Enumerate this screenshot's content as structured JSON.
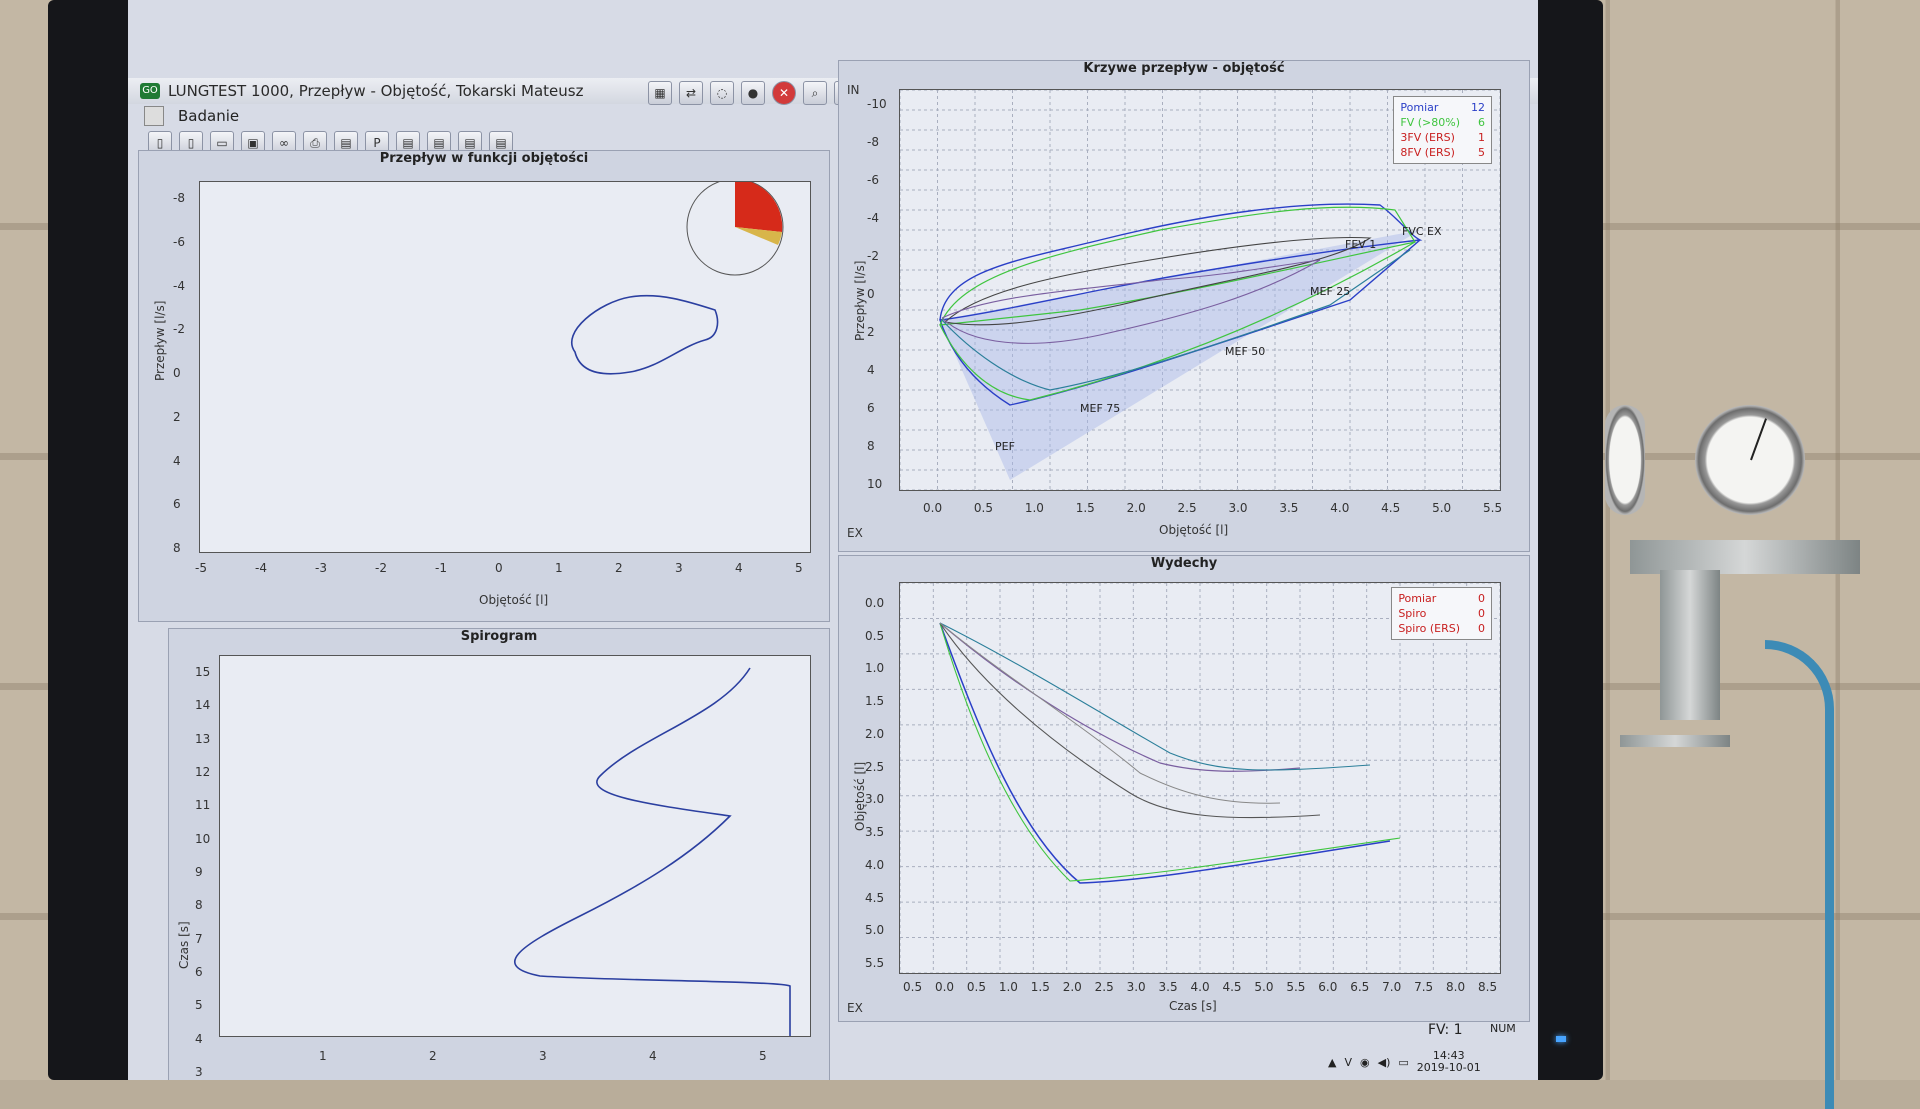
{
  "window": {
    "title": "LUNGTEST 1000,  Przepływ - Objętość,  Tokarski Mateusz",
    "logo_text": "GO"
  },
  "menu": {
    "items": [
      "Badanie"
    ]
  },
  "toolbar": {
    "zero_label": "0",
    "help_label": "?"
  },
  "panels": {
    "flow_volume": {
      "title": "Przepływ w funkcji objętości",
      "ylabel": "Przepływ [l/s]",
      "xlabel": "Objętość [l]",
      "yticks": [
        "-8",
        "-6",
        "-4",
        "-2",
        "0",
        "2",
        "4",
        "6",
        "8"
      ],
      "xticks": [
        "-5",
        "-4",
        "-3",
        "-2",
        "-1",
        "0",
        "1",
        "2",
        "3",
        "4",
        "5"
      ]
    },
    "curves": {
      "title": "Krzywe przepływ - objętość",
      "ylabel": "Przepływ [l/s]",
      "xlabel": "Objętość [l]",
      "corner_in": "IN",
      "corner_ex": "EX",
      "yticks": [
        "-10",
        "-8",
        "-6",
        "-4",
        "-2",
        "0",
        "2",
        "4",
        "6",
        "8",
        "10"
      ],
      "xticks": [
        "0.0",
        "0.5",
        "1.0",
        "1.5",
        "2.0",
        "2.5",
        "3.0",
        "3.5",
        "4.0",
        "4.5",
        "5.0",
        "5.5"
      ],
      "legend": [
        {
          "label": "Pomiar",
          "value": "12",
          "color": "#2a3fc7"
        },
        {
          "label": "FV (>80%)",
          "value": "6",
          "color": "#3fc53f"
        },
        {
          "label": "3FV (ERS)",
          "value": "1",
          "color": "#c82020"
        },
        {
          "label": "8FV (ERS)",
          "value": "5",
          "color": "#c82020"
        }
      ],
      "annotations": {
        "fev1": "FEV 1",
        "fvc": "FVC EX",
        "mef25": "MEF 25",
        "mef50": "MEF 50",
        "mef75": "MEF 75",
        "pef": "PEF"
      }
    },
    "spirogram": {
      "title": "Spirogram",
      "ylabel": "Czas [s]",
      "yticks": [
        "3",
        "4",
        "5",
        "6",
        "7",
        "8",
        "9",
        "10",
        "11",
        "12",
        "13",
        "14",
        "15"
      ],
      "xticks": [
        "1",
        "2",
        "3",
        "4",
        "5"
      ]
    },
    "exhalations": {
      "title": "Wydechy",
      "ylabel": "Objętość [l]",
      "xlabel": "Czas [s]",
      "corner_ex": "EX",
      "yticks": [
        "0.0",
        "0.5",
        "1.0",
        "1.5",
        "2.0",
        "2.5",
        "3.0",
        "3.5",
        "4.0",
        "4.5",
        "5.0",
        "5.5"
      ],
      "xticks": [
        "0.5",
        "0.0",
        "0.5",
        "1.0",
        "1.5",
        "2.0",
        "2.5",
        "3.0",
        "3.5",
        "4.0",
        "4.5",
        "5.0",
        "5.5",
        "6.0",
        "6.5",
        "7.0",
        "7.5",
        "8.0",
        "8.5"
      ],
      "legend": [
        {
          "label": "Pomiar",
          "value": "0",
          "color": "#c82020"
        },
        {
          "label": "Spiro",
          "value": "0",
          "color": "#c82020"
        },
        {
          "label": "Spiro (ERS)",
          "value": "0",
          "color": "#c82020"
        }
      ]
    }
  },
  "status": {
    "fv": "FV: 1",
    "num": "NUM"
  },
  "tray": {
    "time": "14:43",
    "date": "2019-10-01",
    "keyboard_indicator": "V"
  }
}
